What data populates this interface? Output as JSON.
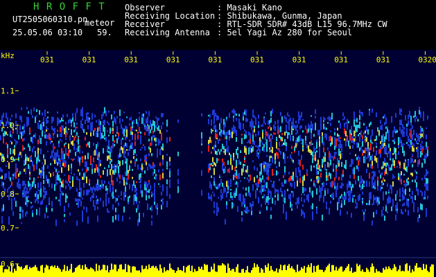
{
  "header": {
    "brand": "H R O F F T",
    "filename": "UT2505060310.pn",
    "mode": "meteor",
    "datetime": "25.05.06 03:10",
    "seconds": "59.",
    "fields": [
      {
        "label": "Observer",
        "value": ": Masaki Kano"
      },
      {
        "label": "Receiving Location",
        "value": ": Shibukawa, Gunma, Japan"
      },
      {
        "label": "Receiver",
        "value": ": RTL-SDR SDR# 43dB L15 96.7MHz CW"
      },
      {
        "label": "Receiving Antenna",
        "value": ": 5el Yagi Az 280 for Seoul"
      }
    ]
  },
  "spectrogram": {
    "unit_label": "kHz",
    "time_labels": [
      "031",
      "031",
      "031",
      "031",
      "031",
      "031",
      "031",
      "031",
      "031",
      "0320"
    ],
    "freq_labels": [
      "1.1",
      "1.0",
      "0.9",
      "0.8",
      "0.7",
      "0.6"
    ],
    "colors": {
      "background": "#000033",
      "tick": "#ffff00",
      "label": "#ffff00",
      "signal_low": "#1d3ad6",
      "signal_mid": "#23c6d6",
      "signal_high": "#d9d640",
      "signal_peak": "#e02020",
      "histogram": "#ffff00"
    }
  }
}
